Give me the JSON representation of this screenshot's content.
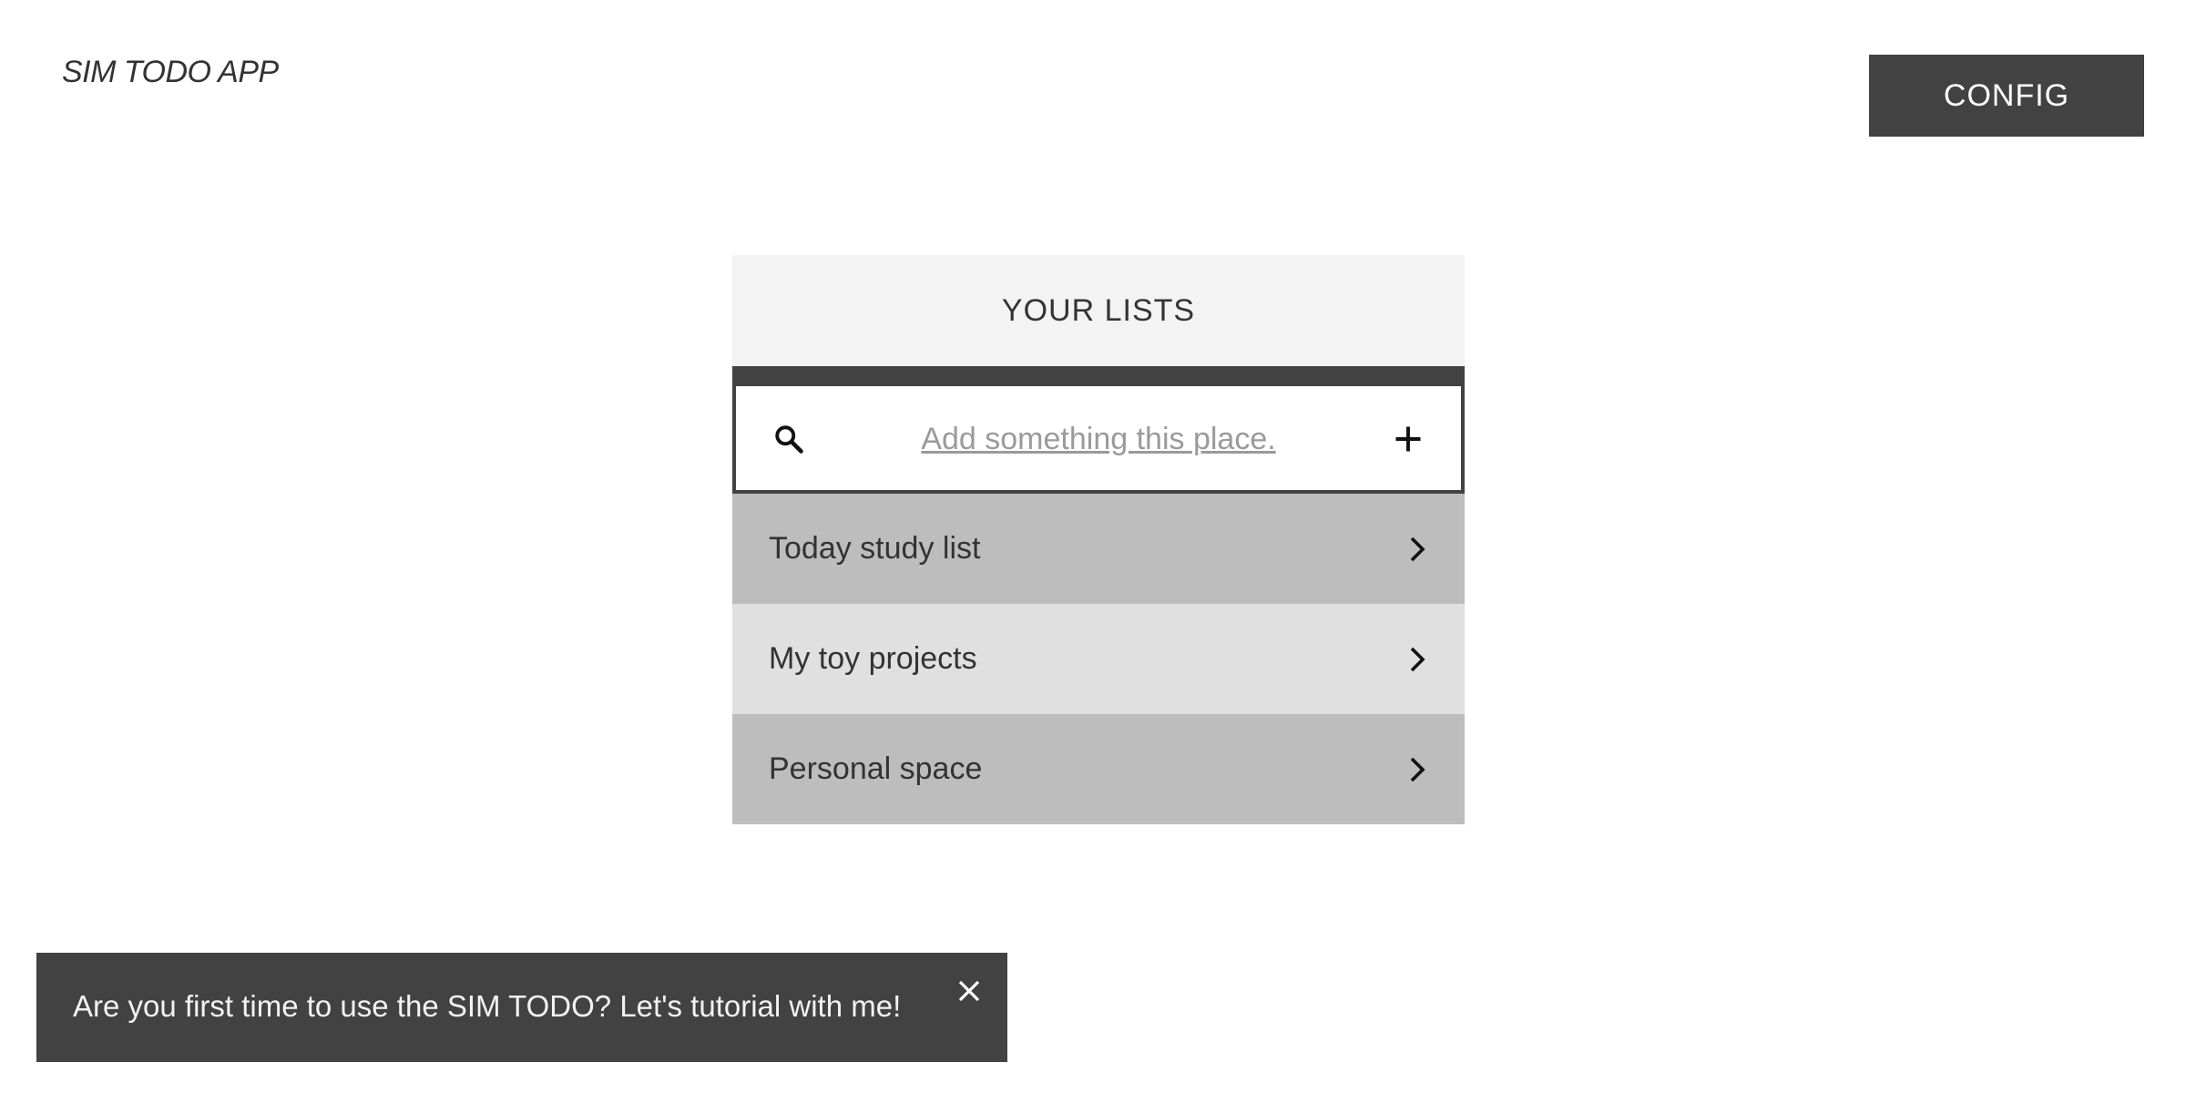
{
  "header": {
    "app_title": "SIM TODO APP",
    "config_label": "CONFIG"
  },
  "lists_panel": {
    "title": "YOUR LISTS",
    "add_input": {
      "placeholder": "Add something this place.",
      "value": ""
    },
    "items": [
      {
        "label": "Today study list",
        "icon": "chevron-right-icon"
      },
      {
        "label": "My toy projects",
        "icon": "chevron-right-icon"
      },
      {
        "label": "Personal space",
        "icon": "chevron-right-icon"
      }
    ],
    "icons": {
      "search": "search-icon",
      "add": "plus-icon"
    }
  },
  "toast": {
    "message": "Are you first time to use the SIM TODO? Let's tutorial with me!",
    "close_icon": "close-icon"
  },
  "colors": {
    "dark": "#424242",
    "header_bg": "#f3f3f3",
    "row_dark": "#bdbdbd",
    "row_light": "#e0e0e0",
    "placeholder": "#9a9a9a"
  }
}
